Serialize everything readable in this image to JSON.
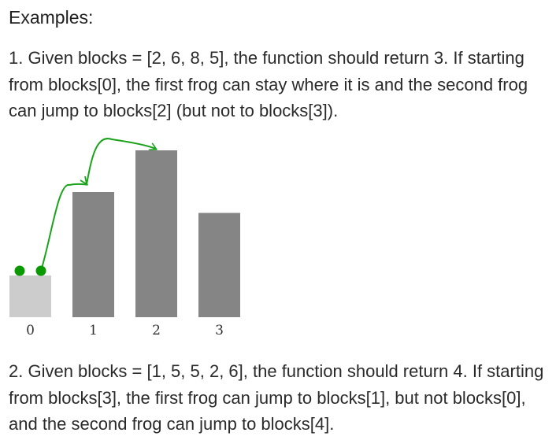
{
  "heading": "Examples:",
  "example1": {
    "text": "1. Given blocks = [2, 6, 8, 5], the function should return 3. If starting from blocks[0], the first frog can stay where it is and the second frog can jump to blocks[2] (but not to blocks[3])."
  },
  "figure": {
    "blocks": [
      {
        "label": "0",
        "height": 2,
        "color": "#cccccc"
      },
      {
        "label": "1",
        "height": 6,
        "color": "#858585"
      },
      {
        "label": "2",
        "height": 8,
        "color": "#858585"
      },
      {
        "label": "3",
        "height": 5,
        "color": "#858585"
      }
    ],
    "frog_color": "#0a9900",
    "arrow_color": "#1aa31a",
    "start_block": 0,
    "jumps": [
      [
        0,
        1
      ],
      [
        1,
        2
      ]
    ]
  },
  "example2": {
    "text": "2. Given blocks = [1, 5, 5, 2, 6], the function should return 4. If starting from blocks[3], the first frog can jump to blocks[1], but not blocks[0], and the second frog can jump to blocks[4]."
  }
}
